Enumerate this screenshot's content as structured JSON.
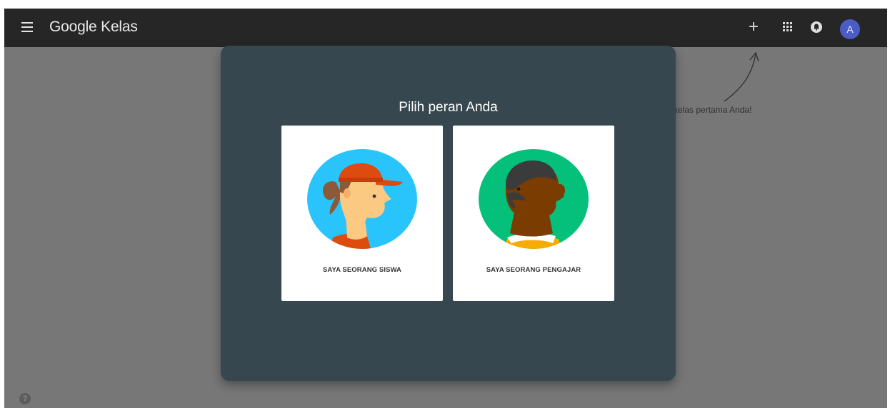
{
  "app": {
    "title": "Google Kelas"
  },
  "topbar": {
    "menu_icon": "hamburger-menu-icon",
    "add_icon_glyph": "+",
    "apps_icon": "apps-grid-icon",
    "notification_icon": "bell-icon",
    "avatar_initial": "A"
  },
  "background": {
    "hint_text": "n kelas pertama Anda!",
    "help_icon_glyph": "?"
  },
  "dialog": {
    "title": "Pilih peran Anda",
    "roles": [
      {
        "label": "SAYA SEORANG SISWA",
        "illustration": "student-avatar-illustration"
      },
      {
        "label": "SAYA SEORANG PENGAJAR",
        "illustration": "teacher-avatar-illustration"
      }
    ]
  },
  "colors": {
    "topbar": "#262626",
    "overlay_background": "#777777",
    "dialog_background": "#37474f",
    "avatar_background": "#4b5cc4",
    "student_circle": "#29c4fb",
    "teacher_circle": "#05c07a"
  }
}
